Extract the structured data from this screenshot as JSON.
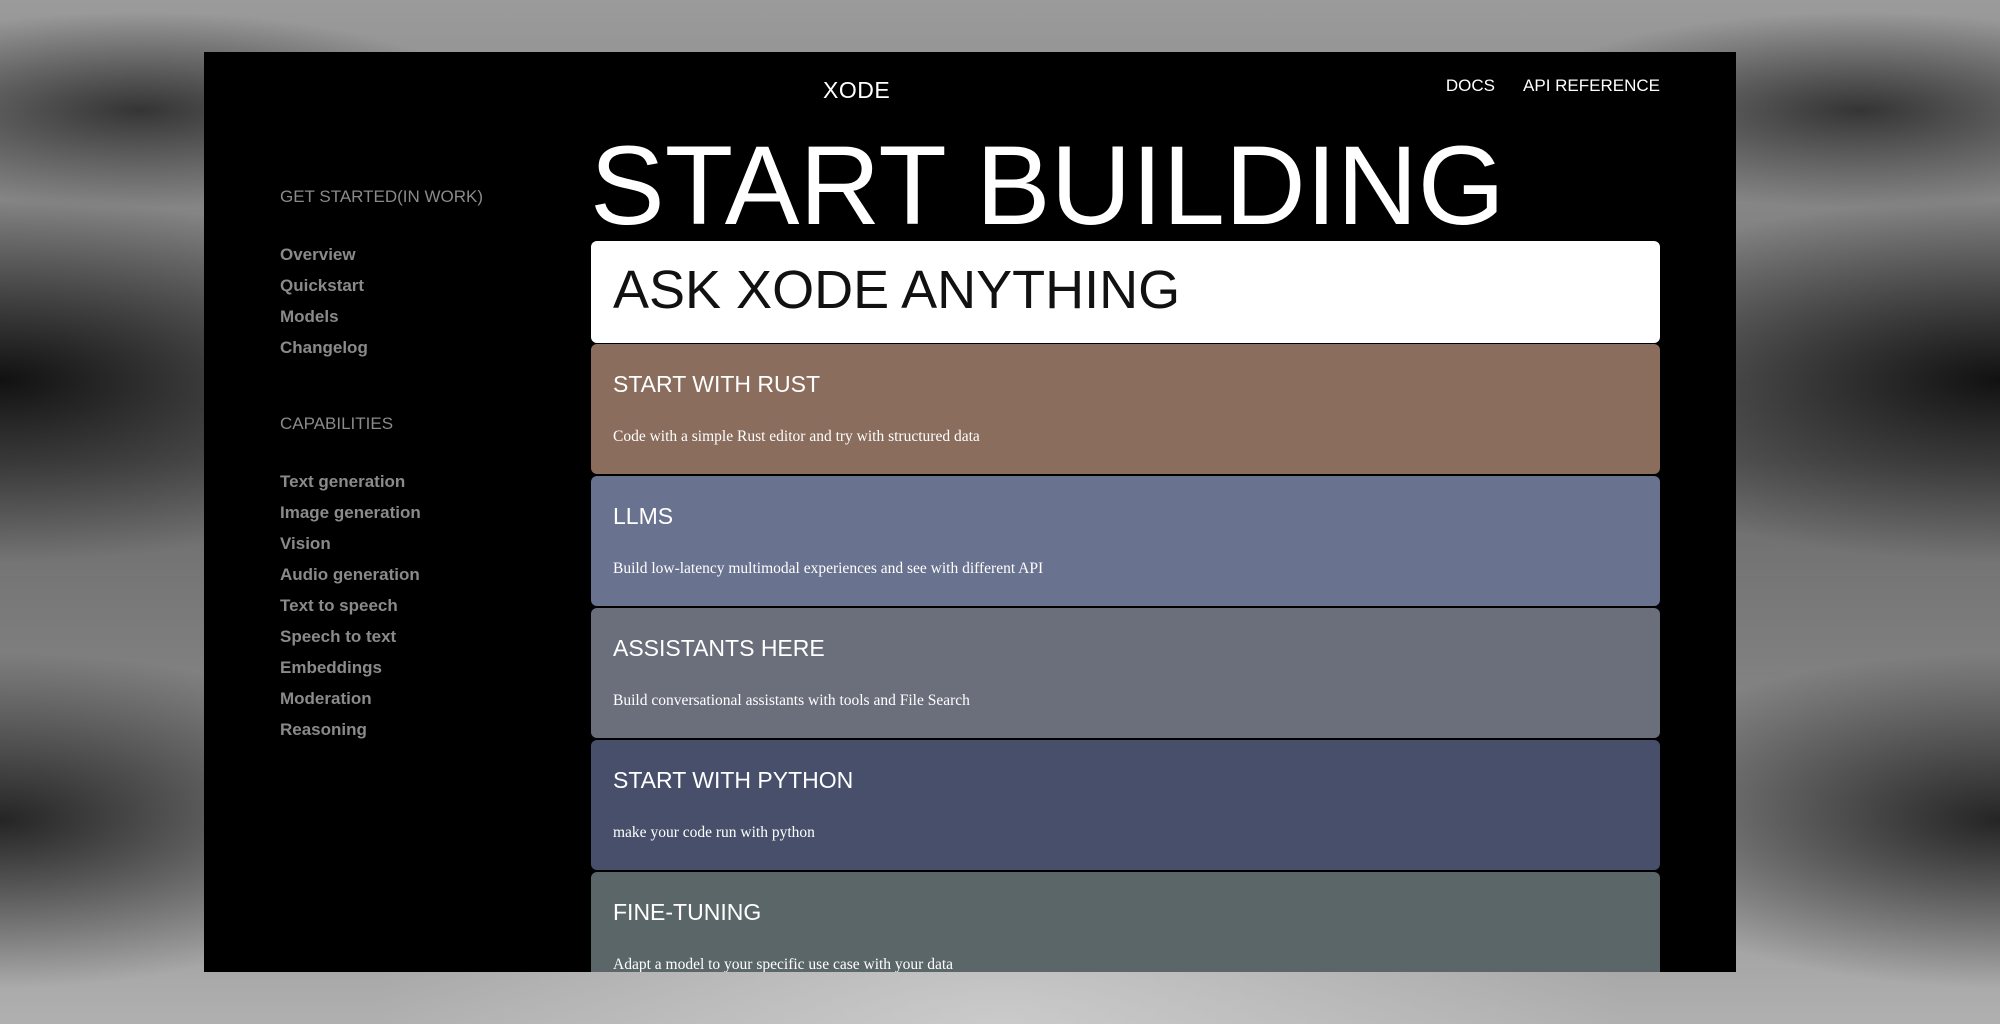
{
  "header": {
    "brand": "XODE",
    "nav": [
      {
        "label": "DOCS"
      },
      {
        "label": "API REFERENCE"
      }
    ]
  },
  "sidebar": {
    "sections": [
      {
        "title": "GET STARTED(IN WORK)",
        "items": [
          {
            "label": "Overview"
          },
          {
            "label": "Quickstart"
          },
          {
            "label": "Models"
          },
          {
            "label": "Changelog"
          }
        ]
      },
      {
        "title": "CAPABILITIES",
        "items": [
          {
            "label": "Text generation"
          },
          {
            "label": "Image generation"
          },
          {
            "label": "Vision"
          },
          {
            "label": "Audio generation"
          },
          {
            "label": "Text to speech"
          },
          {
            "label": "Speech to text"
          },
          {
            "label": "Embeddings"
          },
          {
            "label": "Moderation"
          },
          {
            "label": "Reasoning"
          }
        ]
      }
    ]
  },
  "main": {
    "hero_title": "START BUILDING",
    "ask_card": {
      "label": "ASK XODE ANYTHING"
    },
    "cards": [
      {
        "title": "START WITH RUST",
        "description": "Code with a simple Rust editor and try with structured data",
        "color": "#8a6d5d"
      },
      {
        "title": "LLMS",
        "description": "Build low-latency multimodal experiences and see with different API",
        "color": "#69728f"
      },
      {
        "title": "ASSISTANTS HERE",
        "description": "Build conversational assistants with tools and File Search",
        "color": "#6b6f7b"
      },
      {
        "title": "START WITH PYTHON",
        "description": "make your code run with python",
        "color": "#474f6b"
      },
      {
        "title": "FINE-TUNING",
        "description": "Adapt a model to your specific use case with your data",
        "color": "#5b6669"
      }
    ]
  }
}
